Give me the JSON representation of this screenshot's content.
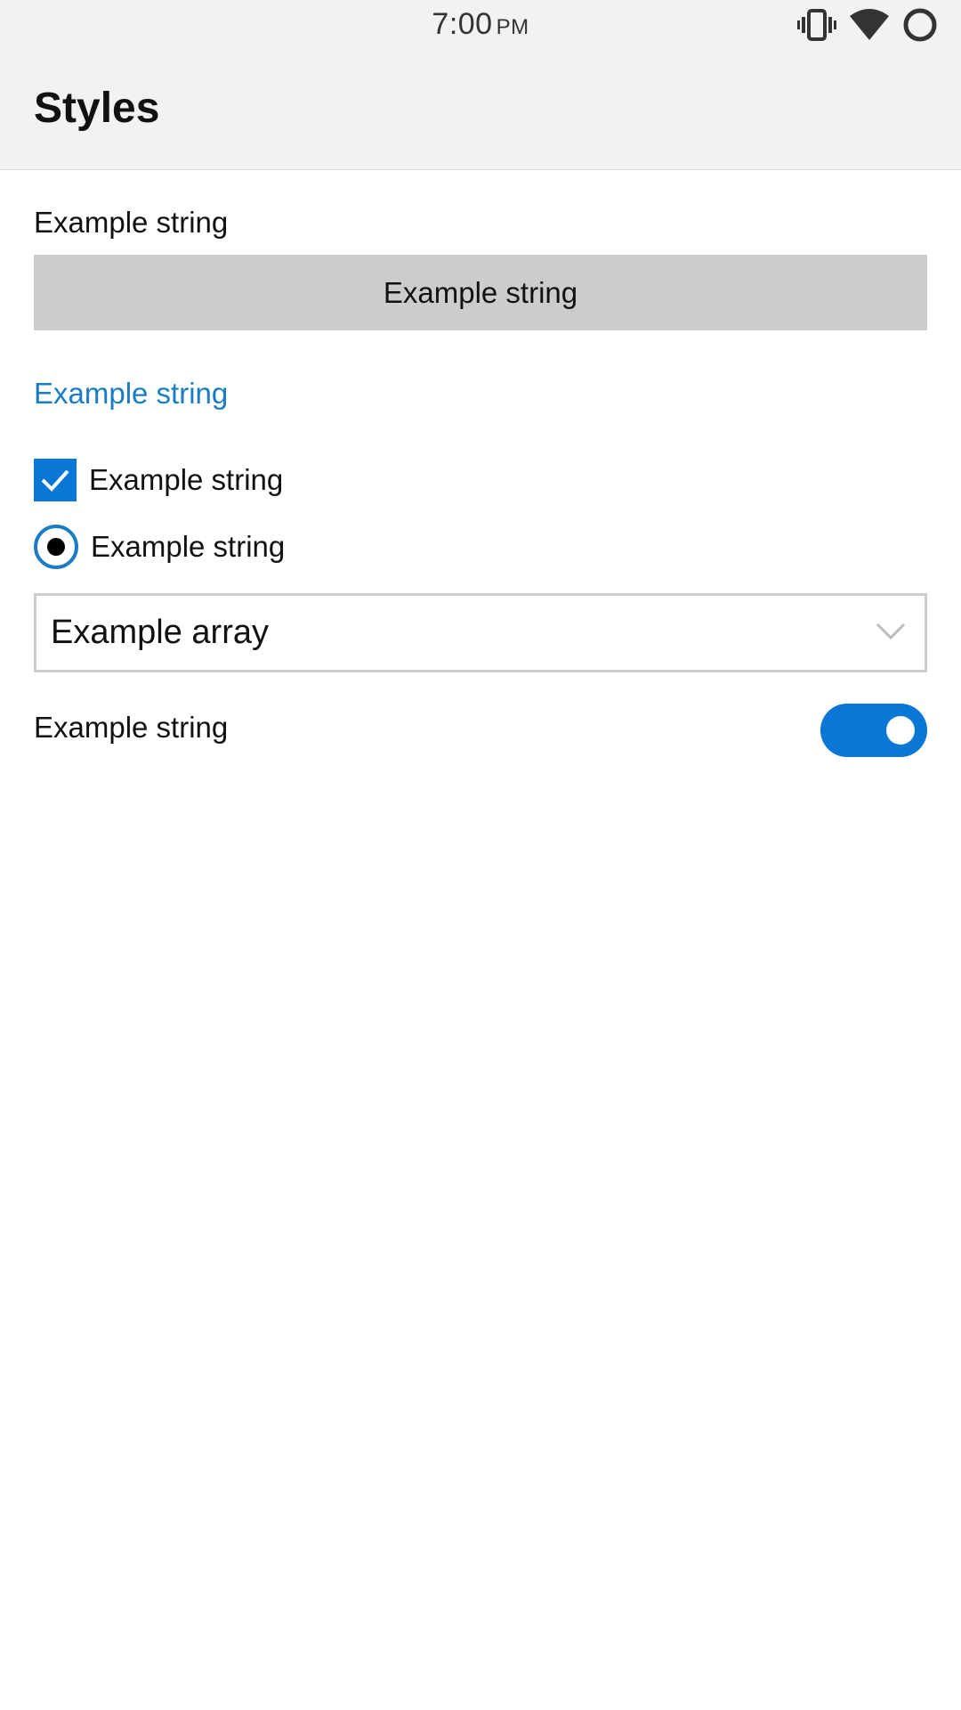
{
  "status_bar": {
    "time": "7:00",
    "ampm": "PM",
    "icons": [
      "vibrate-icon",
      "wifi-icon",
      "battery-ring-icon"
    ]
  },
  "header": {
    "title": "Styles"
  },
  "main": {
    "text_label": "Example string",
    "button_label": "Example string",
    "link_label": "Example string",
    "checkbox": {
      "label": "Example string",
      "checked": true
    },
    "radio": {
      "label": "Example string",
      "selected": true
    },
    "dropdown": {
      "selected_value": "Example array",
      "icon": "chevron-down-icon"
    },
    "switch": {
      "label": "Example string",
      "on": true
    }
  },
  "colors": {
    "accent": "#0a76d6",
    "link": "#1a7dc4",
    "button_background": "#cccccc",
    "header_background": "#f2f2f2"
  }
}
